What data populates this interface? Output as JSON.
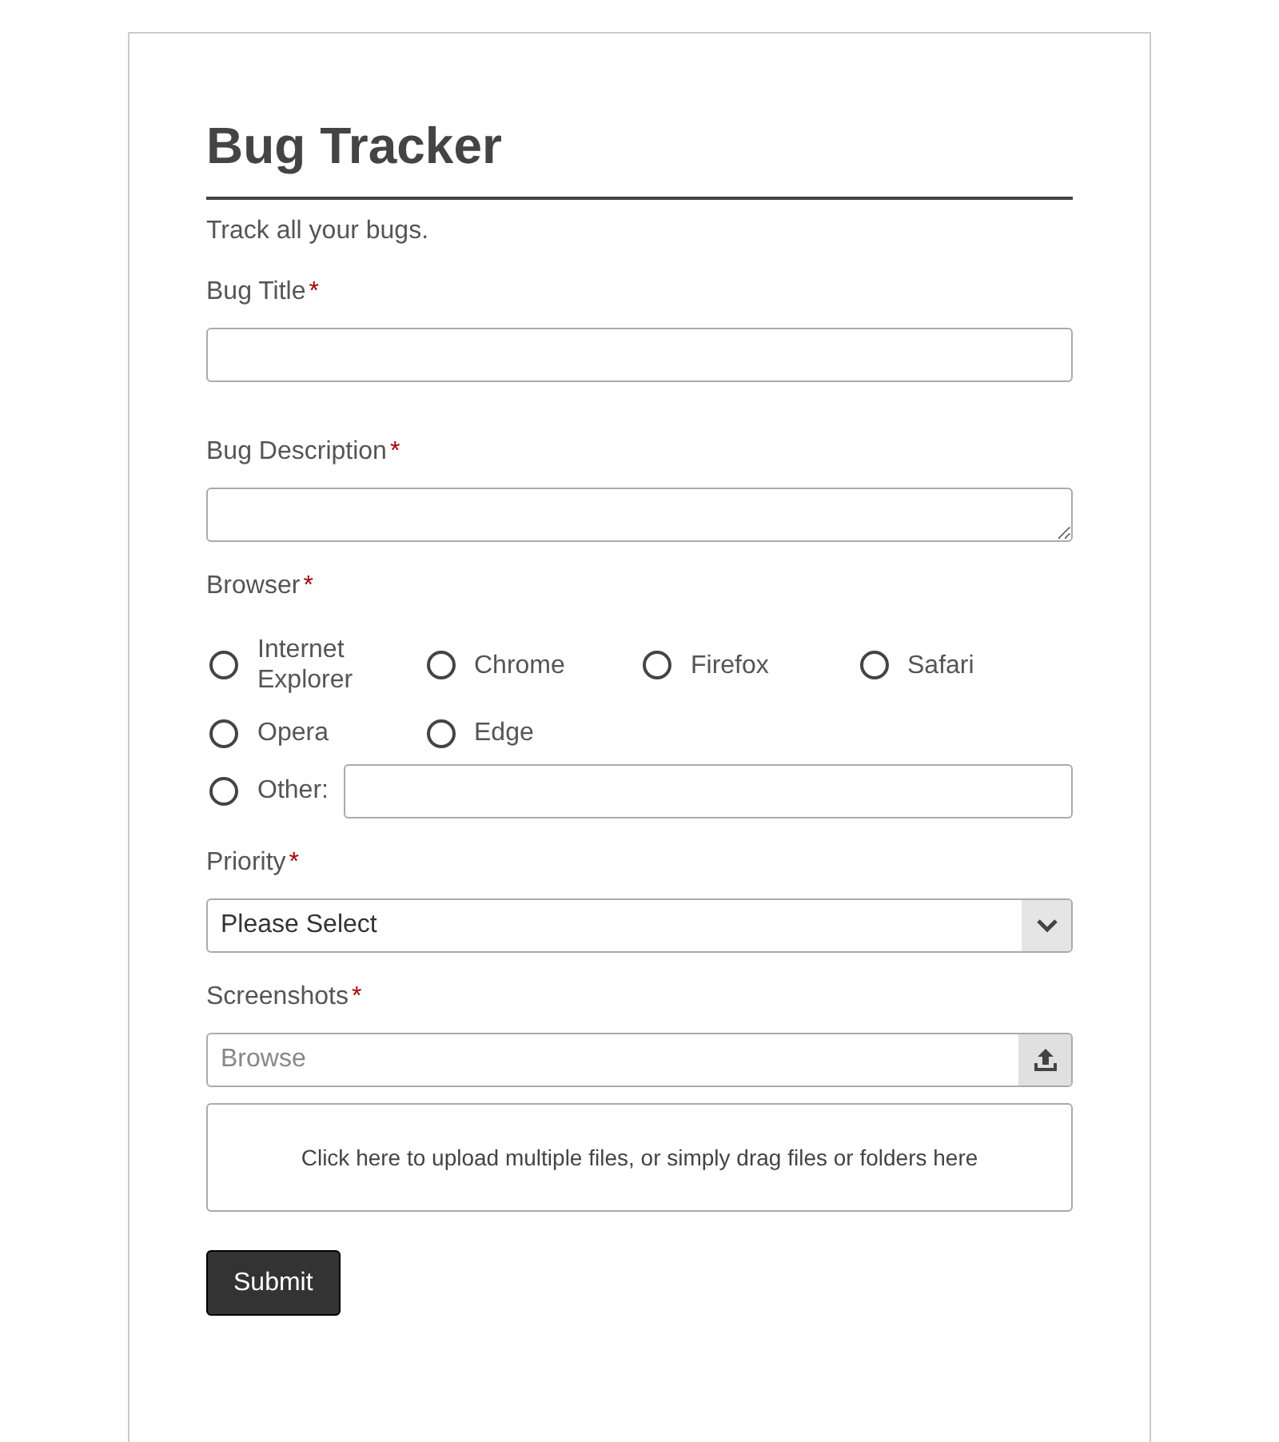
{
  "form": {
    "title": "Bug Tracker",
    "description": "Track all your bugs.",
    "fields": [
      {
        "kind": "text",
        "label": "Bug Title",
        "required_mark": "*"
      },
      {
        "kind": "textarea",
        "label": "Bug Description",
        "required_mark": "*"
      },
      {
        "kind": "radio",
        "label": "Browser",
        "required_mark": "*",
        "options": [
          {
            "label": "Internet Explorer",
            "selected": false
          },
          {
            "label": "Chrome",
            "selected": false
          },
          {
            "label": "Firefox",
            "selected": false
          },
          {
            "label": "Safari",
            "selected": false
          },
          {
            "label": "Opera",
            "selected": false
          },
          {
            "label": "Edge",
            "selected": false
          }
        ],
        "other": {
          "label": "Other:",
          "selected": false
        }
      },
      {
        "kind": "select",
        "label": "Priority",
        "required_mark": "*",
        "value": "Please Select"
      },
      {
        "kind": "file",
        "label": "Screenshots",
        "required_mark": "*",
        "placeholder": "Browse",
        "drop_zone": "Click here to upload multiple files, or simply drag files or folders here"
      }
    ],
    "submit": "Submit"
  }
}
